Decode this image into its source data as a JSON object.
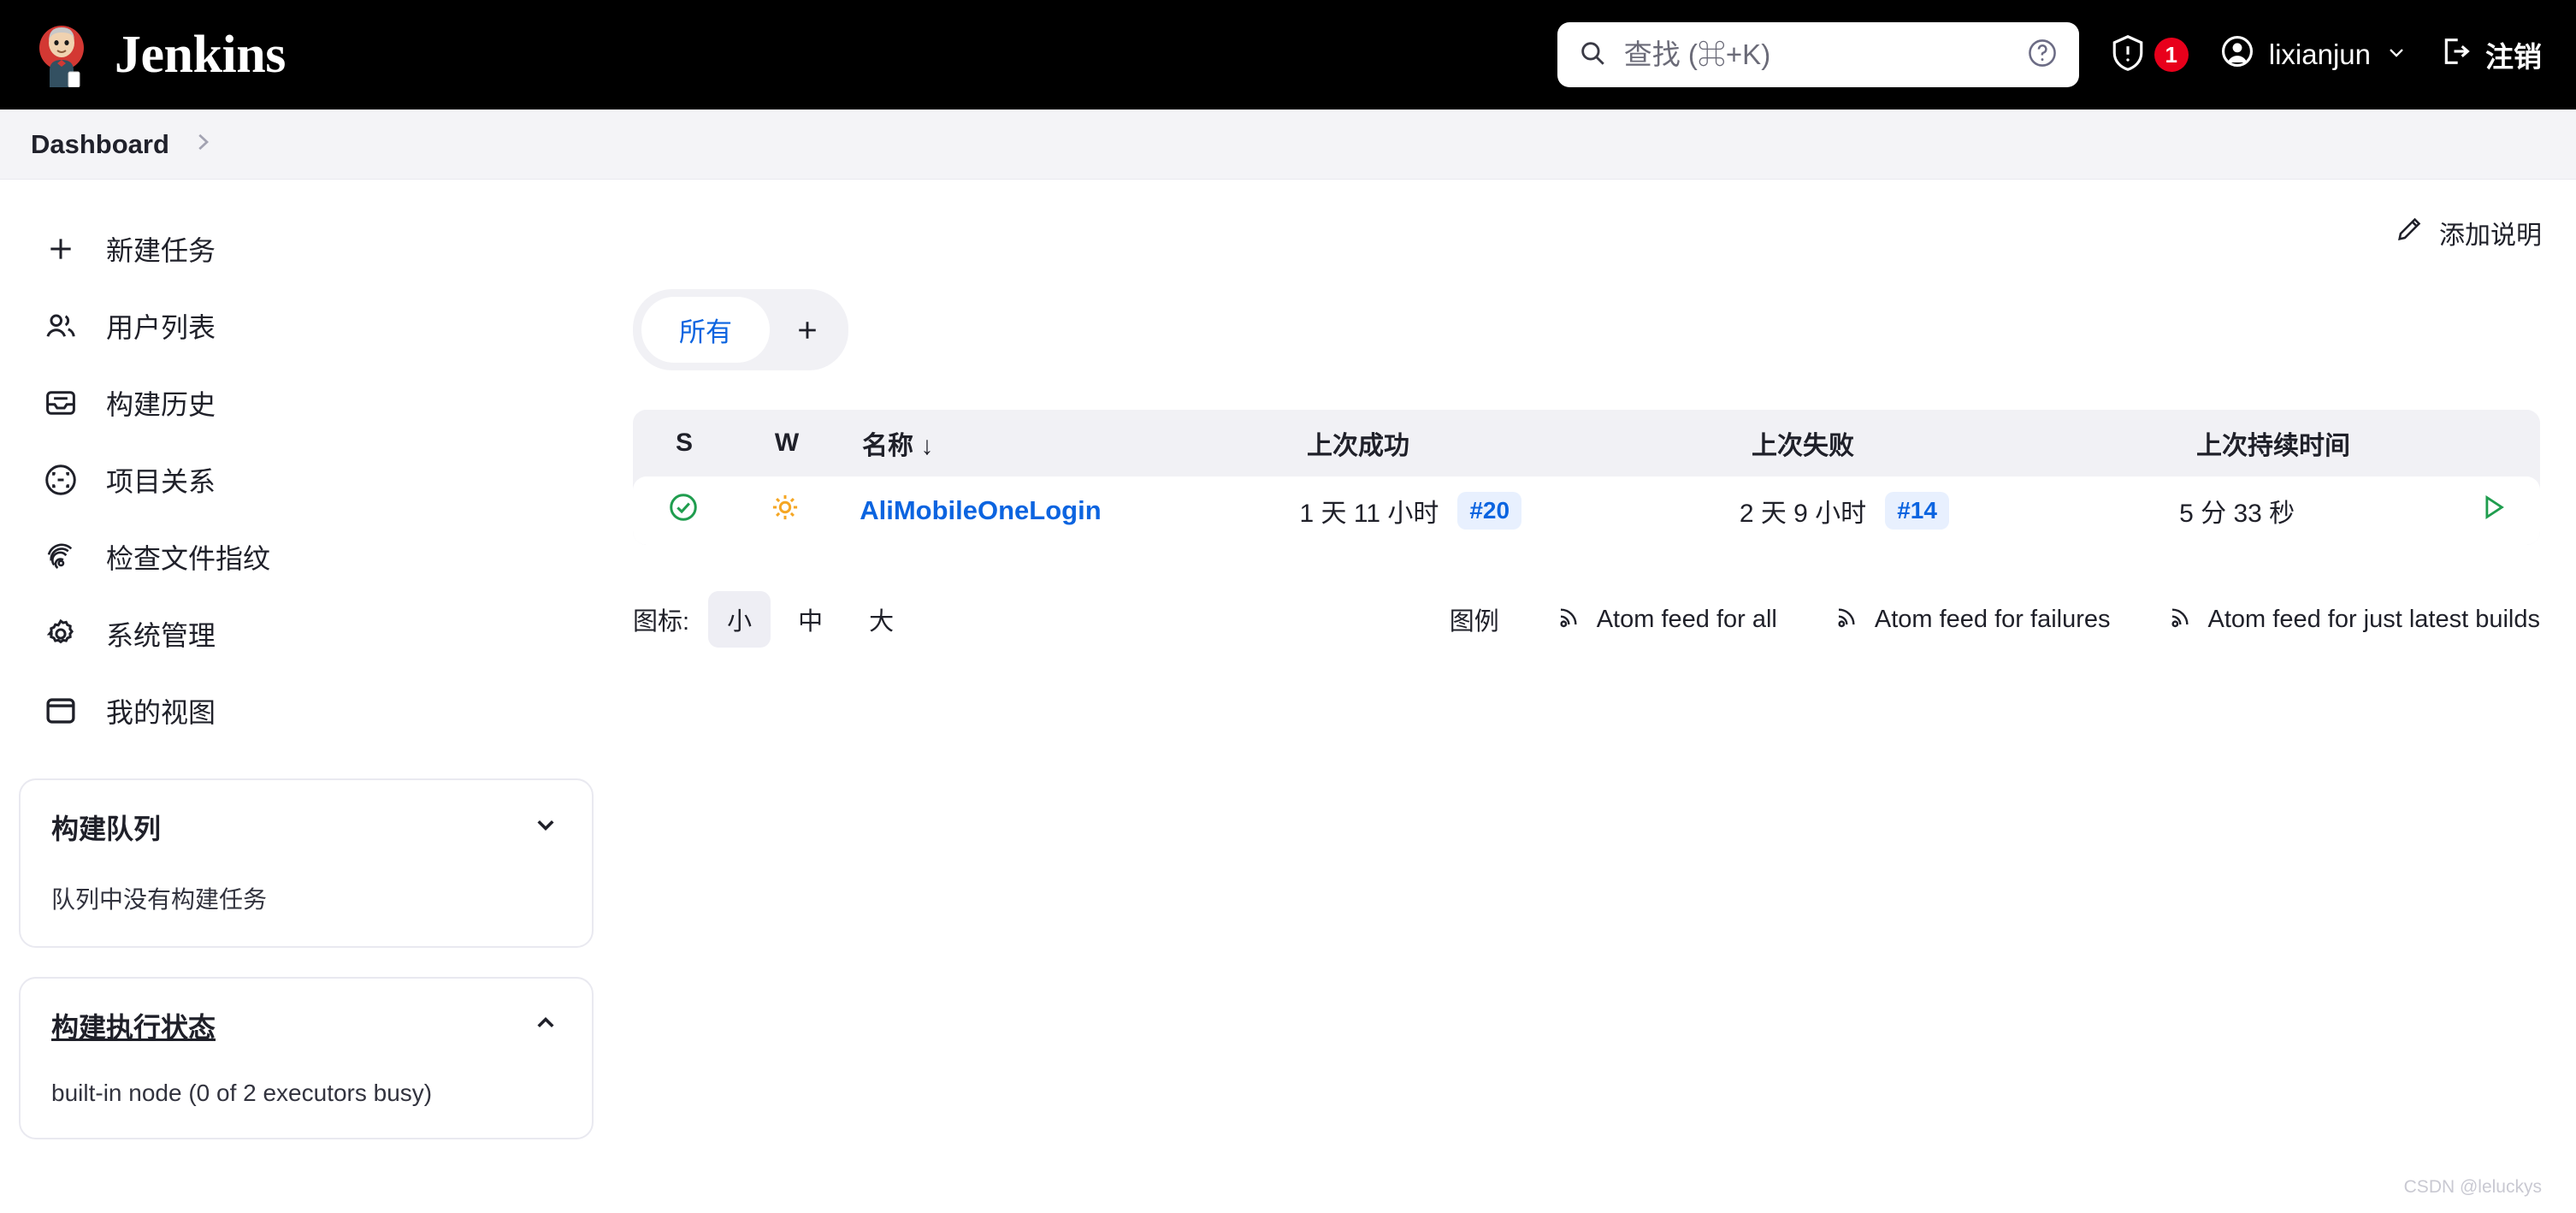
{
  "header": {
    "brand": "Jenkins",
    "brand_logo_icon": "jenkins-butler-logo",
    "search": {
      "placeholder": "查找 (⌘+K)",
      "value": "",
      "search_icon": "search-icon",
      "help_icon": "help-circle-icon"
    },
    "security": {
      "icon": "shield-warning-icon",
      "badge_count": "1"
    },
    "user": {
      "avatar_icon": "user-circle-icon",
      "name": "lixianjun",
      "chevron_icon": "chevron-down-icon"
    },
    "logout": {
      "icon": "logout-icon",
      "label": "注销"
    }
  },
  "breadcrumb": {
    "items": [
      "Dashboard"
    ],
    "separator_icon": "chevron-right-icon"
  },
  "sidebar": {
    "items": [
      {
        "label": "新建任务",
        "icon": "plus-icon"
      },
      {
        "label": "用户列表",
        "icon": "people-icon"
      },
      {
        "label": "构建历史",
        "icon": "inbox-icon"
      },
      {
        "label": "项目关系",
        "icon": "scan-circle-icon"
      },
      {
        "label": "检查文件指纹",
        "icon": "fingerprint-icon"
      },
      {
        "label": "系统管理",
        "icon": "gear-icon"
      },
      {
        "label": "我的视图",
        "icon": "window-icon"
      }
    ],
    "widgets": [
      {
        "title": "构建队列",
        "body": "队列中没有构建任务",
        "chevron": "chevron-down-icon",
        "underlined": false
      },
      {
        "title": "构建执行状态",
        "body": "built-in node (0 of 2 executors busy)",
        "chevron": "chevron-up-icon",
        "underlined": true
      }
    ]
  },
  "main": {
    "describe_button": {
      "label": "添加说明",
      "icon": "pencil-icon"
    },
    "tabs": [
      {
        "label": "所有",
        "active": true
      }
    ],
    "add_tab": {
      "icon": "plus-icon"
    },
    "table": {
      "columns": [
        "S",
        "W",
        "名称",
        "上次成功",
        "上次失败",
        "上次持续时间"
      ],
      "sort_indicator": "↓",
      "sorted_column": "名称",
      "rows": [
        {
          "status_icon": "success-check-circle-icon",
          "status_color": "#1f9d4e",
          "weather_icon": "sunny-icon",
          "weather_color": "#f5a623",
          "name": "AliMobileOneLogin",
          "last_success_time": "1 天 11 小时",
          "last_success_build": "#20",
          "last_failure_time": "2 天 9 小时",
          "last_failure_build": "#14",
          "last_duration": "5 分 33 秒",
          "run_icon": "play-triangle-icon",
          "run_color": "#1f9d4e"
        }
      ]
    },
    "footer": {
      "icon_size_label": "图标:",
      "icon_sizes": [
        {
          "label": "小",
          "active": true
        },
        {
          "label": "中",
          "active": false
        },
        {
          "label": "大",
          "active": false
        }
      ],
      "legend_label": "图例",
      "feeds": [
        {
          "label": "Atom feed for all",
          "icon": "rss-icon"
        },
        {
          "label": "Atom feed for failures",
          "icon": "rss-icon"
        },
        {
          "label": "Atom feed for just latest builds",
          "icon": "rss-icon"
        }
      ]
    }
  },
  "watermark": "CSDN @leluckys",
  "colors": {
    "header_bg": "#000000",
    "accent_blue": "#0b64e0",
    "success_green": "#1f9d4e",
    "weather_amber": "#f5a623",
    "badge_red": "#e8001b",
    "panel_gray": "#f1f1f5"
  }
}
